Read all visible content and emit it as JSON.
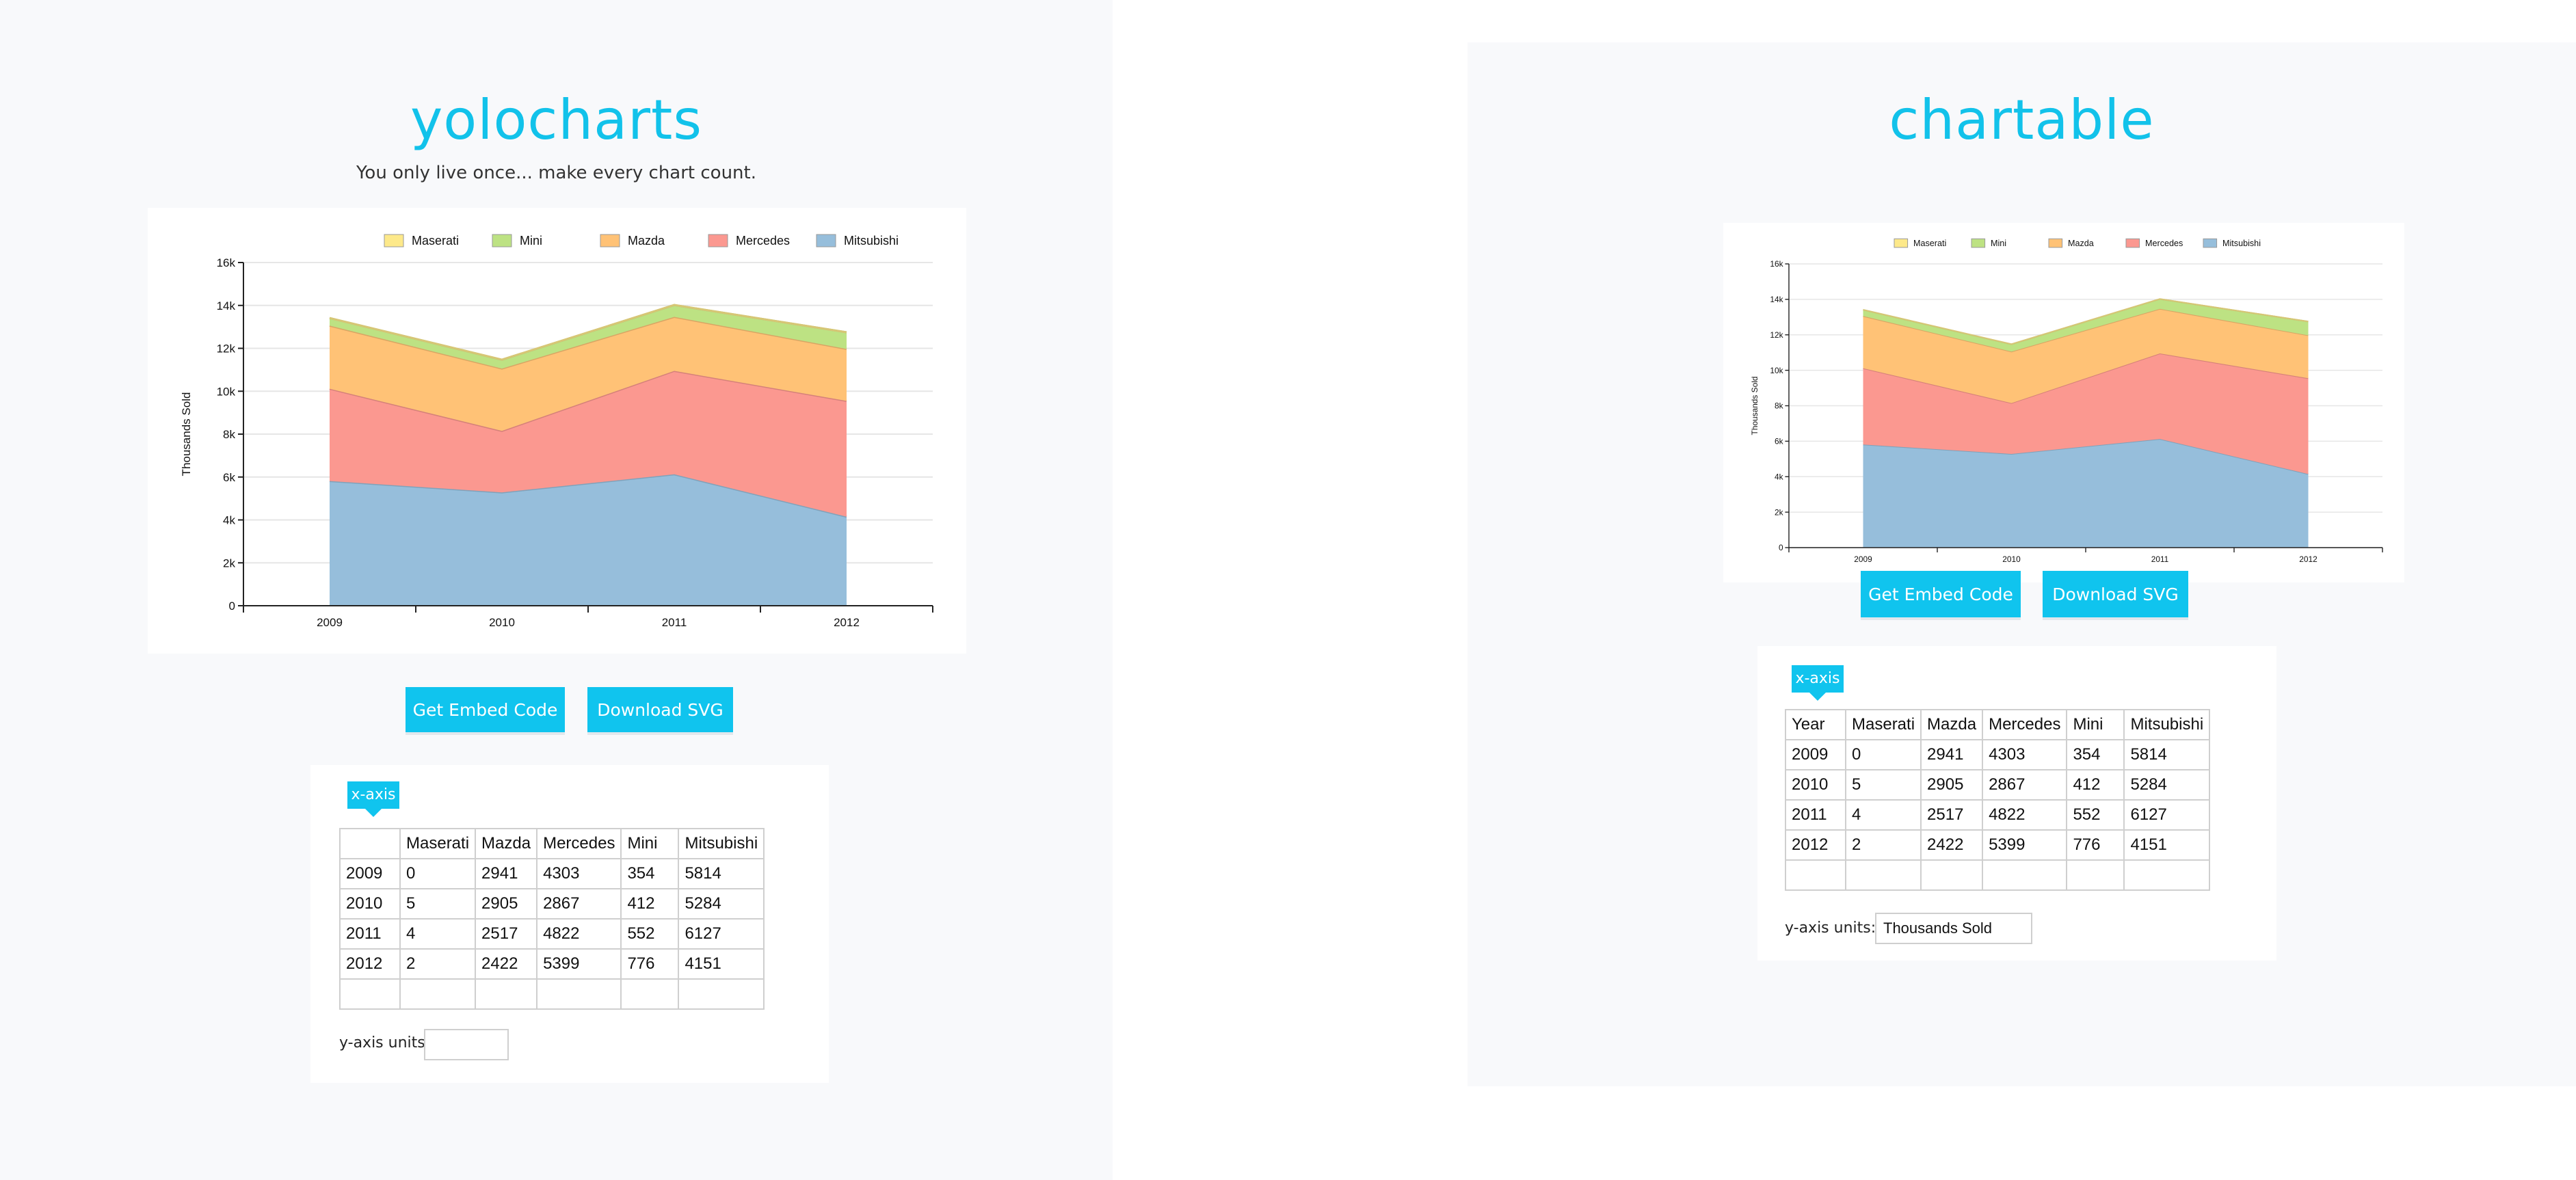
{
  "left": {
    "brand": "yolocharts",
    "tagline": "You only live once... make every chart count.",
    "buttons": {
      "embed": "Get Embed Code",
      "download": "Download SVG"
    },
    "editor": {
      "tag": "x-axis",
      "header": [
        "",
        "Maserati",
        "Mazda",
        "Mercedes",
        "Mini",
        "Mitsubishi"
      ],
      "rows": [
        [
          "2009",
          "0",
          "2941",
          "4303",
          "354",
          "5814"
        ],
        [
          "2010",
          "5",
          "2905",
          "2867",
          "412",
          "5284"
        ],
        [
          "2011",
          "4",
          "2517",
          "4822",
          "552",
          "6127"
        ],
        [
          "2012",
          "2",
          "2422",
          "5399",
          "776",
          "4151"
        ],
        [
          "",
          "",
          "",
          "",
          "",
          ""
        ]
      ],
      "yunits_label": "y-axis units:",
      "yunits_value": ""
    }
  },
  "right": {
    "brand": "chartable",
    "buttons": {
      "embed": "Get Embed Code",
      "download": "Download SVG"
    },
    "editor": {
      "tag": "x-axis",
      "header": [
        "Year",
        "Maserati",
        "Mazda",
        "Mercedes",
        "Mini",
        "Mitsubishi"
      ],
      "rows": [
        [
          "2009",
          "0",
          "2941",
          "4303",
          "354",
          "5814"
        ],
        [
          "2010",
          "5",
          "2905",
          "2867",
          "412",
          "5284"
        ],
        [
          "2011",
          "4",
          "2517",
          "4822",
          "552",
          "6127"
        ],
        [
          "2012",
          "2",
          "2422",
          "5399",
          "776",
          "4151"
        ],
        [
          "",
          "",
          "",
          "",
          "",
          ""
        ]
      ],
      "yunits_label": "y-axis units:",
      "yunits_value": "Thousands Sold"
    }
  },
  "colors": {
    "accent": "#10c4ee",
    "Maserati": "#fde98a",
    "Mini": "#bde283",
    "Mazda": "#ffc276",
    "Mercedes": "#fb9890",
    "Mitsubishi": "#96bedb"
  },
  "chart_data": [
    {
      "type": "area",
      "stacked": true,
      "categories": [
        "2009",
        "2010",
        "2011",
        "2012"
      ],
      "series": [
        {
          "name": "Mitsubishi",
          "values": [
            5814,
            5284,
            6127,
            4151
          ]
        },
        {
          "name": "Mercedes",
          "values": [
            4303,
            2867,
            4822,
            5399
          ]
        },
        {
          "name": "Mazda",
          "values": [
            2941,
            2905,
            2517,
            2422
          ]
        },
        {
          "name": "Mini",
          "values": [
            354,
            412,
            552,
            776
          ]
        },
        {
          "name": "Maserati",
          "values": [
            0,
            5,
            4,
            2
          ]
        }
      ],
      "legend_order": [
        "Maserati",
        "Mini",
        "Mazda",
        "Mercedes",
        "Mitsubishi"
      ],
      "legend_position": "top-right",
      "ylabel": "Thousands Sold",
      "ylim": [
        0,
        16000
      ],
      "yticks": [
        "0",
        "2k",
        "4k",
        "6k",
        "8k",
        "10k",
        "12k",
        "14k",
        "16k"
      ],
      "grid": true
    },
    {
      "type": "area",
      "stacked": true,
      "categories": [
        "2009",
        "2010",
        "2011",
        "2012"
      ],
      "series": [
        {
          "name": "Mitsubishi",
          "values": [
            5814,
            5284,
            6127,
            4151
          ]
        },
        {
          "name": "Mercedes",
          "values": [
            4303,
            2867,
            4822,
            5399
          ]
        },
        {
          "name": "Mazda",
          "values": [
            2941,
            2905,
            2517,
            2422
          ]
        },
        {
          "name": "Mini",
          "values": [
            354,
            412,
            552,
            776
          ]
        },
        {
          "name": "Maserati",
          "values": [
            0,
            5,
            4,
            2
          ]
        }
      ],
      "legend_order": [
        "Maserati",
        "Mini",
        "Mazda",
        "Mercedes",
        "Mitsubishi"
      ],
      "legend_position": "top-right",
      "ylabel": "Thousands Sold",
      "ylim": [
        0,
        16000
      ],
      "yticks": [
        "0",
        "2k",
        "4k",
        "6k",
        "8k",
        "10k",
        "12k",
        "14k",
        "16k"
      ],
      "grid": true
    }
  ]
}
